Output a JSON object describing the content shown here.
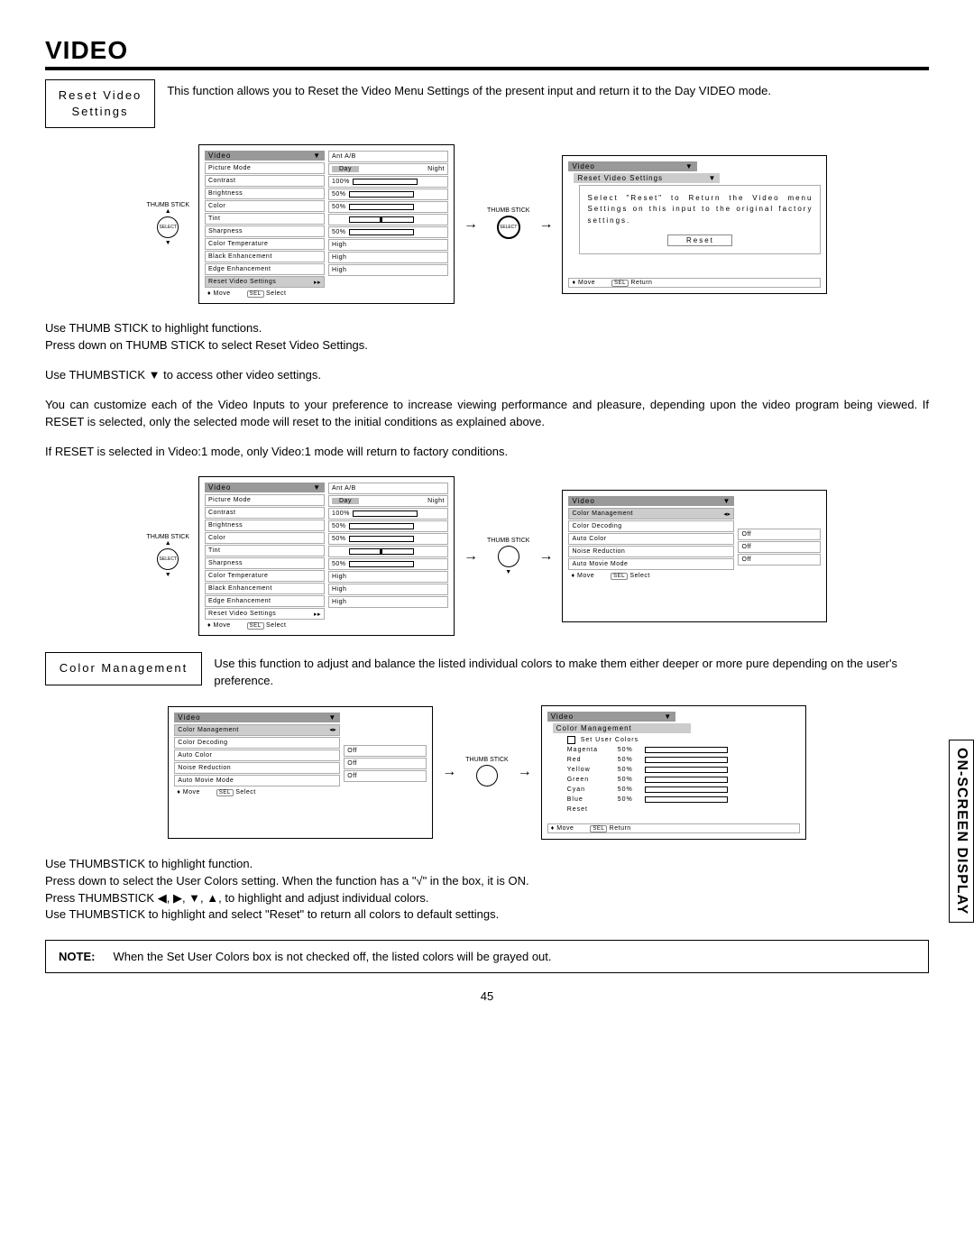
{
  "title": "VIDEO",
  "side_tab": "ON-SCREEN DISPLAY",
  "page_number": "45",
  "reset_video": {
    "label": "Reset Video Settings",
    "desc": "This function allows you to Reset the Video Menu Settings of the present input and return it to the Day VIDEO mode."
  },
  "thumb_label": "THUMB STICK",
  "select_label": "SELECT",
  "video_menu": {
    "header": "Video",
    "ant": "Ant A/B",
    "day": "Day",
    "night": "Night",
    "items": [
      {
        "label": "Picture Mode"
      },
      {
        "label": "Contrast",
        "pct": "100%",
        "fill": 100
      },
      {
        "label": "Brightness",
        "pct": "50%",
        "fill": 50
      },
      {
        "label": "Color",
        "pct": "50%",
        "fill": 50
      },
      {
        "label": "Tint",
        "tick": 50
      },
      {
        "label": "Sharpness",
        "pct": "50%",
        "fill": 50
      },
      {
        "label": "Color Temperature",
        "right": "High"
      },
      {
        "label": "Black Enhancement",
        "right": "High"
      },
      {
        "label": "Edge Enhancement",
        "right": "High"
      },
      {
        "label": "Reset Video Settings",
        "arrow": true
      }
    ],
    "footer_move": "Move",
    "footer_sel": "Select",
    "footer_ret": "Return"
  },
  "reset_confirm": {
    "header": "Video",
    "sub": "Reset Video Settings",
    "msg": "Select \"Reset\" to Return the Video menu Settings on this input to the original factory settings.",
    "reset": "Reset"
  },
  "para1": "Use THUMB STICK to highlight functions.",
  "para2": "Press down on THUMB STICK to select Reset Video Settings.",
  "para3": "Use THUMBSTICK ▼ to access other video settings.",
  "para4": "You can customize each of the Video Inputs to your preference to increase viewing performance and pleasure, depending upon the video program being viewed. If RESET is selected, only the selected mode will reset to the initial conditions as explained above.",
  "para5": "If RESET is selected in Video:1 mode, only Video:1 mode will return to factory conditions.",
  "color_mgmt": {
    "label": "Color Management",
    "desc": "Use this function to adjust and balance the listed individual colors to make them either deeper or more pure depending on the user's preference.",
    "menu_items": [
      {
        "label": "Color Management",
        "arrow": true
      },
      {
        "label": "Color Decoding"
      },
      {
        "label": "Auto Color",
        "right": "Off"
      },
      {
        "label": "Noise Reduction",
        "right": "Off"
      },
      {
        "label": "Auto Movie Mode",
        "right": "Off"
      }
    ],
    "set_user": "Set User Colors",
    "colors": [
      {
        "name": "Magenta",
        "pct": "50%"
      },
      {
        "name": "Red",
        "pct": "50%"
      },
      {
        "name": "Yellow",
        "pct": "50%"
      },
      {
        "name": "Green",
        "pct": "50%"
      },
      {
        "name": "Cyan",
        "pct": "50%"
      },
      {
        "name": "Blue",
        "pct": "50%"
      }
    ],
    "reset": "Reset"
  },
  "para6": "Use THUMBSTICK to highlight function.",
  "para7": "Press down to select the User Colors setting.  When the function has a \"√\" in the box, it is ON.",
  "para8": "Press THUMBSTICK ◀, ▶, ▼, ▲, to highlight and adjust individual colors.",
  "para9": "Use THUMBSTICK to highlight and select \"Reset\" to return all colors to default settings.",
  "note": {
    "label": "NOTE:",
    "text": "When the Set User Colors box is not checked off, the listed colors will be grayed out."
  }
}
